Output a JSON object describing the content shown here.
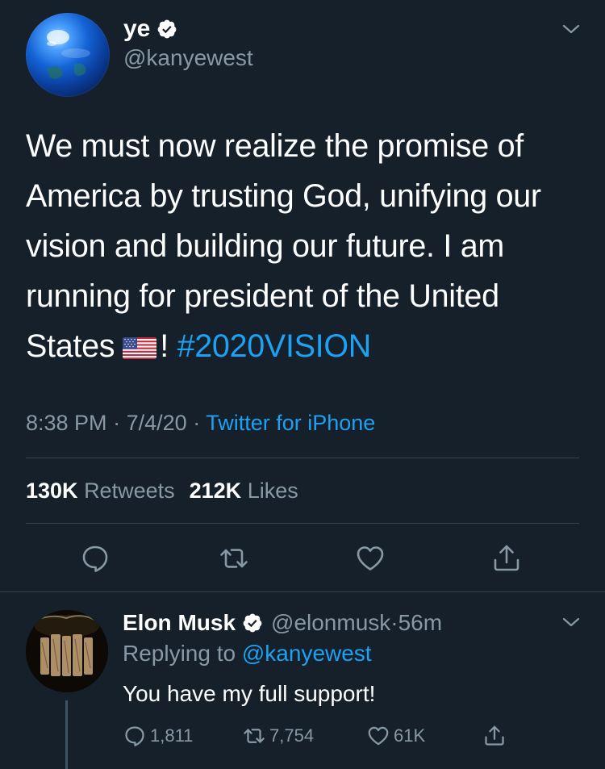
{
  "colors": {
    "background": "#15202b",
    "text_primary": "#ffffff",
    "text_secondary": "#8899a6",
    "accent": "#1da1f2",
    "divider": "#38444d"
  },
  "main_tweet": {
    "author": {
      "name": "ye",
      "handle": "@kanyewest",
      "verified": true,
      "avatar_icon": "earth-avatar"
    },
    "text_before_hashtag": "We must now realize the promise of America by trusting God, unifying our vision and building our future. I am running for president of the United States",
    "flag_icon": "us-flag-emoji",
    "text_exclamation": "!",
    "hashtag": "#2020VISION",
    "time": "8:38 PM",
    "separator": "·",
    "date": "7/4/20",
    "source": "Twitter for iPhone",
    "retweets_count": "130K",
    "retweets_label": "Retweets",
    "likes_count": "212K",
    "likes_label": "Likes",
    "actions": [
      "reply-icon",
      "retweet-icon",
      "like-icon",
      "share-icon"
    ]
  },
  "reply_tweet": {
    "author": {
      "name": "Elon Musk",
      "handle": "@elonmusk",
      "verified": true,
      "avatar_icon": "elonmusk-avatar"
    },
    "separator": "·",
    "time_ago": "56m",
    "replying_to_label": "Replying to",
    "replying_to_handle": "@kanyewest",
    "text": "You have my full support!",
    "reply_count": "1,811",
    "retweet_count": "7,754",
    "like_count": "61K"
  }
}
